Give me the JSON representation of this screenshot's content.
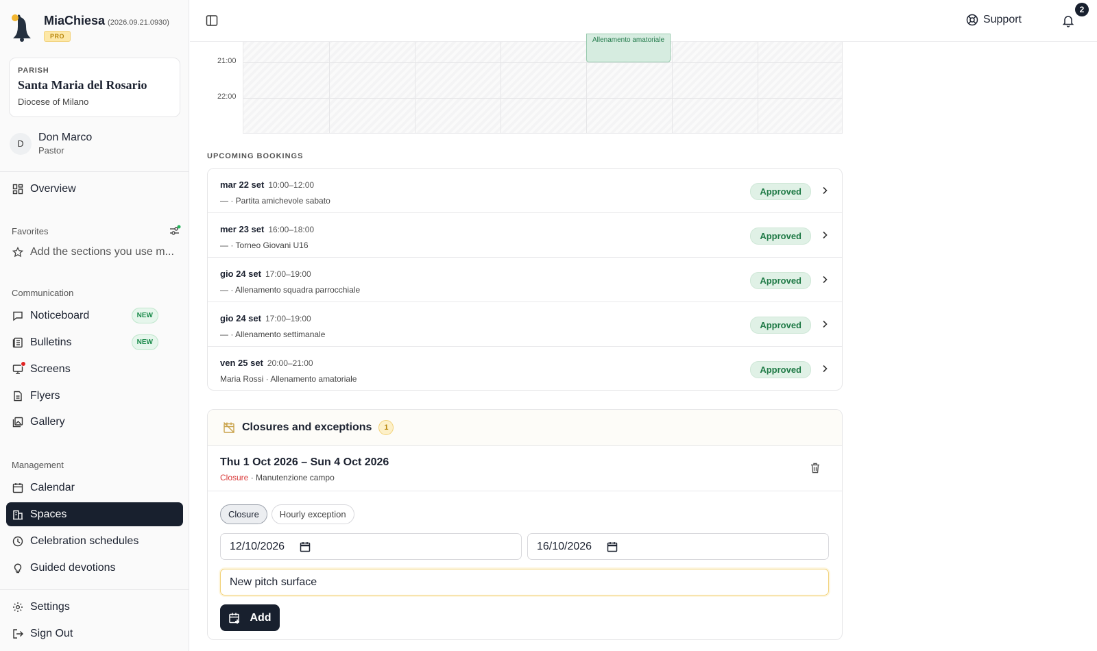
{
  "brand": {
    "name": "MiaChiesa",
    "version": "(2026.09.21.0930)",
    "tier": "PRO"
  },
  "parish": {
    "kicker": "PARISH",
    "name": "Santa Maria del Rosario",
    "diocese": "Diocese of Milano"
  },
  "user": {
    "initial": "D",
    "name": "Don Marco",
    "role": "Pastor"
  },
  "nav": {
    "overview": "Overview",
    "favorites_label": "Favorites",
    "favorites_hint": "Add the sections you use m...",
    "communication_label": "Communication",
    "communication": [
      {
        "label": "Noticeboard",
        "badge": "NEW",
        "icon": "chat-bubble-icon"
      },
      {
        "label": "Bulletins",
        "badge": "NEW",
        "icon": "newspaper-icon"
      },
      {
        "label": "Screens",
        "icon": "monitor-icon"
      },
      {
        "label": "Flyers",
        "icon": "file-icon"
      },
      {
        "label": "Gallery",
        "icon": "gallery-icon"
      }
    ],
    "management_label": "Management",
    "management": [
      {
        "label": "Calendar",
        "icon": "calendar-icon"
      },
      {
        "label": "Spaces",
        "icon": "building-icon",
        "active": true
      },
      {
        "label": "Celebration schedules",
        "icon": "clock-icon"
      },
      {
        "label": "Guided devotions",
        "icon": "lightbulb-icon"
      }
    ],
    "settings": "Settings",
    "sign_out": "Sign Out"
  },
  "topbar": {
    "support": "Support",
    "notifications": "2"
  },
  "calendar": {
    "times": [
      "21:00",
      "22:00"
    ],
    "event": "Allenamento amatoriale"
  },
  "upcoming": {
    "label": "UPCOMING BOOKINGS",
    "items": [
      {
        "date": "mar 22 set",
        "time": "10:00–12:00",
        "desc": "— · Partita amichevole sabato",
        "status": "Approved"
      },
      {
        "date": "mer 23 set",
        "time": "16:00–18:00",
        "desc": "— · Torneo Giovani U16",
        "status": "Approved"
      },
      {
        "date": "gio 24 set",
        "time": "17:00–19:00",
        "desc": "— · Allenamento squadra parrocchiale",
        "status": "Approved"
      },
      {
        "date": "gio 24 set",
        "time": "17:00–19:00",
        "desc": "— · Allenamento settimanale",
        "status": "Approved"
      },
      {
        "date": "ven 25 set",
        "time": "20:00–21:00",
        "desc": "Maria Rossi · Allenamento amatoriale",
        "status": "Approved"
      }
    ]
  },
  "closures": {
    "title": "Closures and exceptions",
    "count": "1",
    "entry": {
      "range": "Thu 1 Oct 2026 – Sun 4 Oct 2026",
      "type": "Closure",
      "note": " · Manutenzione campo"
    },
    "tabs": [
      "Closure",
      "Hourly exception"
    ],
    "from_date": "12/10/2026",
    "to_date": "16/10/2026",
    "reason": "New pitch surface",
    "add_label": "Add"
  },
  "colors": {
    "accent_dark": "#18202e",
    "approved_green": "#1f7a46",
    "closure_red": "#d93a3a",
    "pro_gold": "#b8860b"
  }
}
